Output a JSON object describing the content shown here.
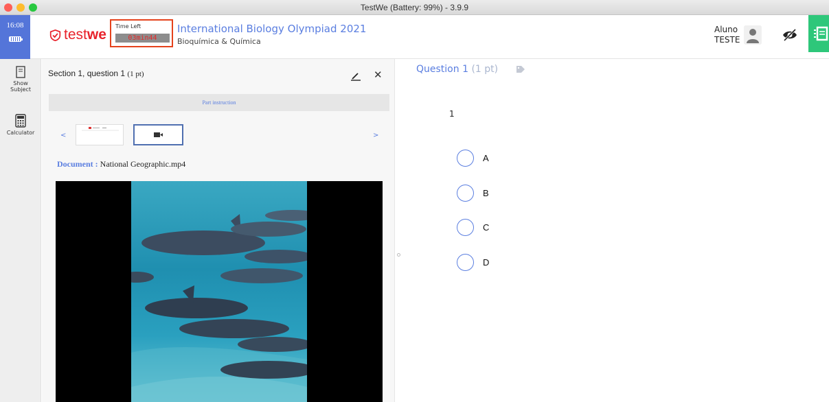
{
  "window": {
    "title": "TestWe (Battery: 99%) - 3.9.9"
  },
  "header": {
    "clock_time": "16:08",
    "logo_text_light": "test",
    "logo_text_bold": "we",
    "timer_label": "Time Left",
    "timer_value": "03min44",
    "exam_title": "International Biology Olympiad 2021",
    "exam_subtitle": "Bioquímica & Química",
    "user_first": "Aluno",
    "user_last": "TESTE"
  },
  "sidebar": {
    "items": [
      {
        "label_line1": "Show",
        "label_line2": "Subject",
        "icon": "document-icon"
      },
      {
        "label_line1": "Calculator",
        "label_line2": "",
        "icon": "calculator-icon"
      }
    ]
  },
  "left_panel": {
    "heading": "Section 1, question 1",
    "heading_points": "(1 pt)",
    "part_instruction": "Part instruction",
    "prev_arrow": "<",
    "next_arrow": ">",
    "document_key": "Document :",
    "document_name": "National Geographic.mp4"
  },
  "question": {
    "title": "Question 1",
    "points": "(1 pt)",
    "text": "1",
    "options": [
      "A",
      "B",
      "C",
      "D"
    ]
  },
  "colors": {
    "accent": "#5a7ee0",
    "brand_red": "#e8222b",
    "timer_border": "#e5421c",
    "clock_bg": "#5475d9",
    "green": "#2ec77a"
  }
}
